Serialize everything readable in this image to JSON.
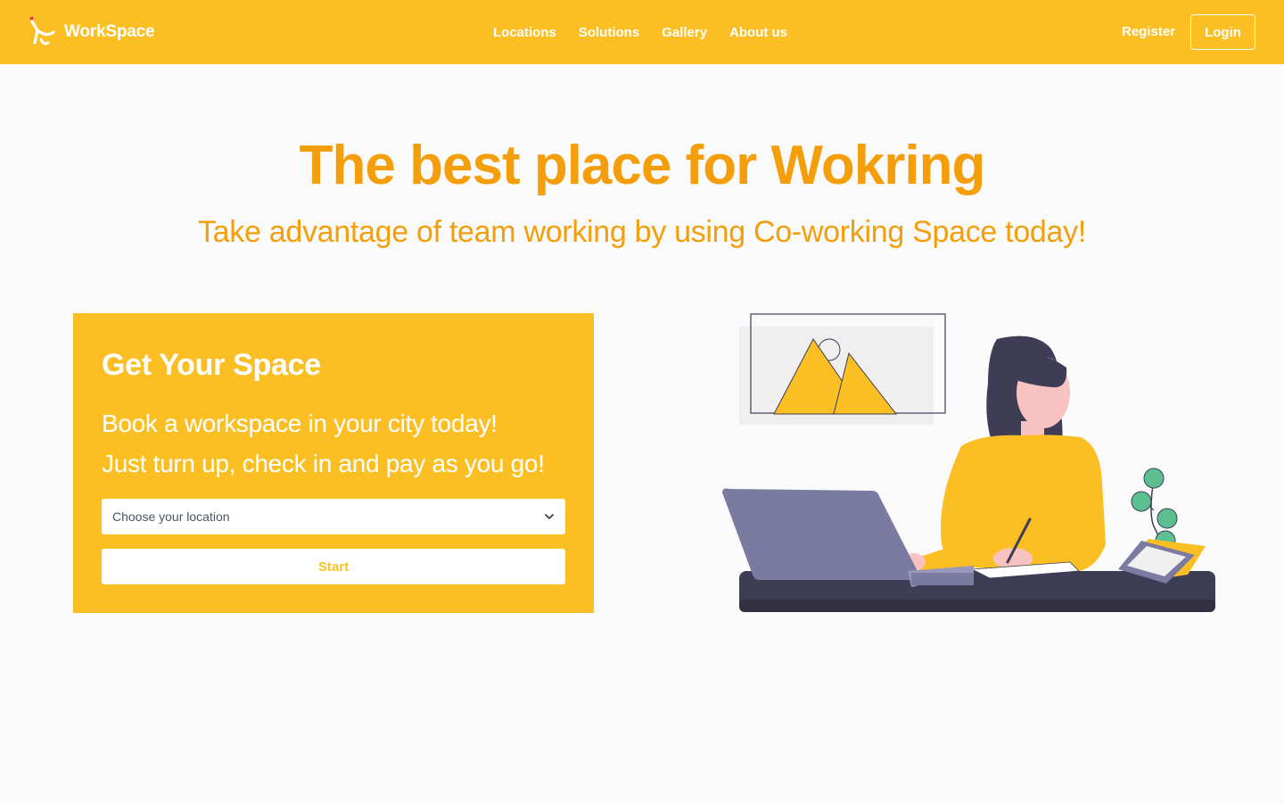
{
  "colors": {
    "brand": "#fbbf24",
    "heading": "#f59e0b",
    "background": "#fafafa",
    "illustration_dark": "#3f3d56",
    "laptop": "#7b7aa0",
    "plant": "#5cbf8f"
  },
  "header": {
    "brand_icon": "workspace-logo-icon",
    "brand_name": "WorkSpace",
    "nav": [
      {
        "label": "Locations"
      },
      {
        "label": "Solutions"
      },
      {
        "label": "Gallery"
      },
      {
        "label": "About us"
      }
    ],
    "register_label": "Register",
    "login_label": "Login"
  },
  "hero": {
    "title": "The best place for Wokring",
    "subtitle": "Take advantage of team working by using Co-working Space today!"
  },
  "booking_card": {
    "title": "Get Your Space",
    "line1": "Book a workspace in your city today!",
    "line2": "Just turn up, check in and pay as you go!",
    "location_select": {
      "selected": "Choose your location",
      "icon": "chevron-down-icon"
    },
    "start_label": "Start"
  },
  "illustration": {
    "icon": "woman-working-at-laptop-illustration"
  }
}
